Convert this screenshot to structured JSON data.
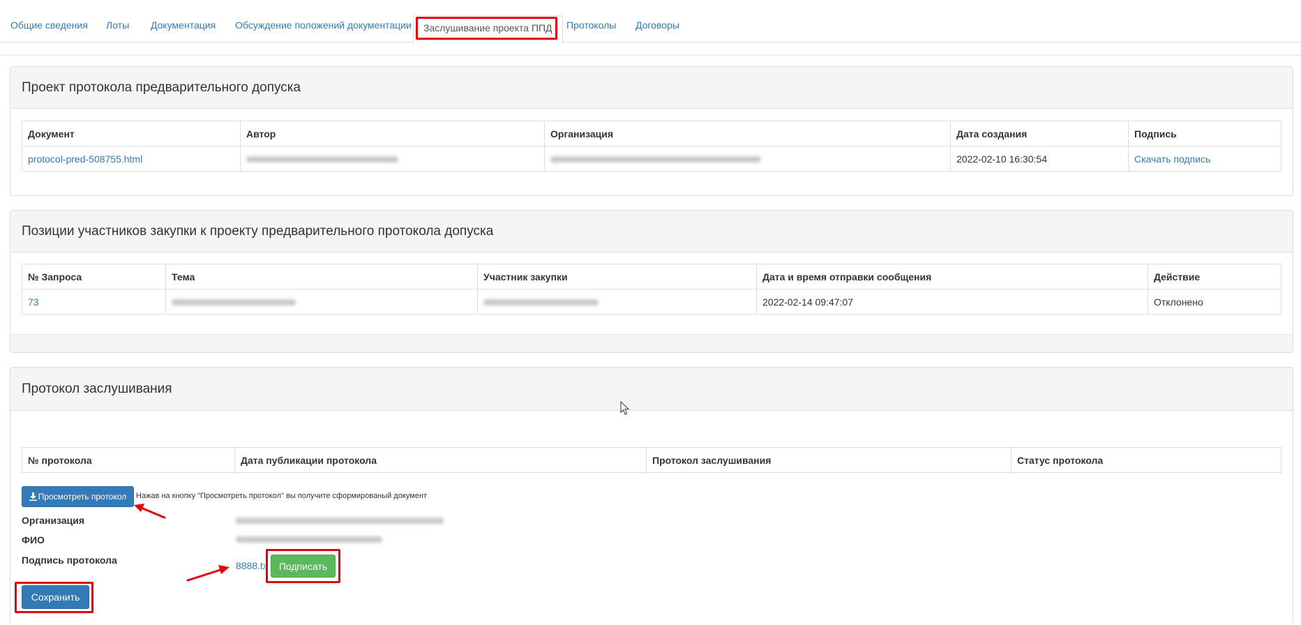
{
  "tabs": [
    {
      "label": "Общие сведения"
    },
    {
      "label": "Лоты"
    },
    {
      "label": "Документация"
    },
    {
      "label": "Обсуждение положений документации"
    },
    {
      "label": "Заслушивание проекта ППД"
    },
    {
      "label": "Протоколы"
    },
    {
      "label": "Договоры"
    }
  ],
  "draft_panel": {
    "title": "Проект протокола предварительного допуска",
    "columns": [
      "Документ",
      "Автор",
      "Организация",
      "Дата создания",
      "Подпись"
    ],
    "row": {
      "document": "protocol-pred-508755.html",
      "created": "2022-02-10 16:30:54",
      "signature": "Скачать подпись"
    }
  },
  "positions_panel": {
    "title": "Позиции участников закупки к проекту предварительного протокола допуска",
    "columns": [
      "№ Запроса",
      "Тема",
      "Участник закупки",
      "Дата и время отправки сообщения",
      "Действие"
    ],
    "row": {
      "request_no": "73",
      "sent_at": "2022-02-14 09:47:07",
      "action": "Отклонено"
    }
  },
  "hearing_panel": {
    "title": "Протокол заслушивания",
    "columns": [
      "№ протокола",
      "Дата публикации протокола",
      "Протокол заслушивания",
      "Статус протокола"
    ],
    "view_button": "Просмотреть протокол",
    "hint": "Нажав на кнопку \"Просмотреть протокол\" вы получите сформированый документ",
    "org_label": "Организация",
    "fio_label": "ФИО",
    "sign_label": "Подпись протокола",
    "file_link": "8888.txt",
    "sign_button": "Подписать",
    "save_button": "Сохранить"
  },
  "colors": {
    "link": "#337ab7",
    "primary": "#337ab7",
    "success": "#5cb85c",
    "annotation": "#e3000f"
  }
}
